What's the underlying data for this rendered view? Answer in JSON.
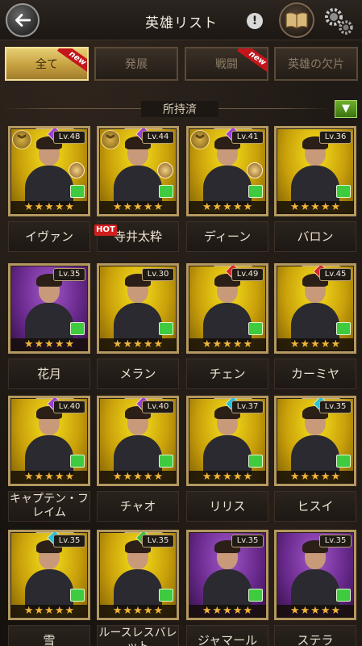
{
  "header": {
    "title": "英雄リスト",
    "info_icon": "!"
  },
  "tabs": [
    {
      "label": "全て",
      "active": true,
      "ribbon": "new"
    },
    {
      "label": "発展",
      "active": false,
      "ribbon": ""
    },
    {
      "label": "戦闘",
      "active": false,
      "ribbon": "new"
    },
    {
      "label": "英雄の欠片",
      "active": false,
      "ribbon": ""
    }
  ],
  "section": {
    "title": "所持済",
    "filter_icon": "▼"
  },
  "badges": {
    "hot": "HOT"
  },
  "heroes": [
    {
      "name": "イヴァン",
      "level": "Lv.48",
      "stars": 5,
      "bg": "gold",
      "gem": "purple",
      "rank": true
    },
    {
      "name": "寺井太粋",
      "level": "Lv.44",
      "stars": 5,
      "bg": "gold",
      "gem": "purple",
      "rank": true
    },
    {
      "name": "ディーン",
      "level": "Lv.41",
      "stars": 5,
      "bg": "gold",
      "gem": "purple",
      "rank": true
    },
    {
      "name": "バロン",
      "level": "Lv.36",
      "stars": 5,
      "bg": "gold",
      "gem": "",
      "rank": false
    },
    {
      "name": "花月",
      "level": "Lv.35",
      "stars": 5,
      "bg": "purple",
      "gem": "",
      "rank": false
    },
    {
      "name": "メラン",
      "level": "Lv.30",
      "stars": 5,
      "bg": "gold",
      "gem": "",
      "rank": false
    },
    {
      "name": "チェン",
      "level": "Lv.49",
      "stars": 5,
      "bg": "gold",
      "gem": "red",
      "rank": false
    },
    {
      "name": "カーミヤ",
      "level": "Lv.45",
      "stars": 5,
      "bg": "gold",
      "gem": "red",
      "rank": false
    },
    {
      "name": "キャプテン・フレイム",
      "level": "Lv.40",
      "stars": 5,
      "bg": "gold",
      "gem": "purple",
      "rank": false
    },
    {
      "name": "チャオ",
      "level": "Lv.40",
      "stars": 5,
      "bg": "gold",
      "gem": "purple",
      "rank": false
    },
    {
      "name": "リリス",
      "level": "Lv.37",
      "stars": 5,
      "bg": "gold",
      "gem": "teal",
      "rank": false
    },
    {
      "name": "ヒスイ",
      "level": "Lv.35",
      "stars": 5,
      "bg": "gold",
      "gem": "teal",
      "rank": false
    },
    {
      "name": "雪",
      "level": "Lv.35",
      "stars": 5,
      "bg": "gold",
      "gem": "teal",
      "rank": false
    },
    {
      "name": "ルースレスバレット",
      "level": "Lv.35",
      "stars": 5,
      "bg": "gold",
      "gem": "green",
      "rank": false
    },
    {
      "name": "ジャマール",
      "level": "Lv.35",
      "stars": 5,
      "bg": "purple",
      "gem": "",
      "rank": false
    },
    {
      "name": "ステラ",
      "level": "Lv.35",
      "stars": 5,
      "bg": "purple",
      "gem": "",
      "rank": false
    }
  ]
}
